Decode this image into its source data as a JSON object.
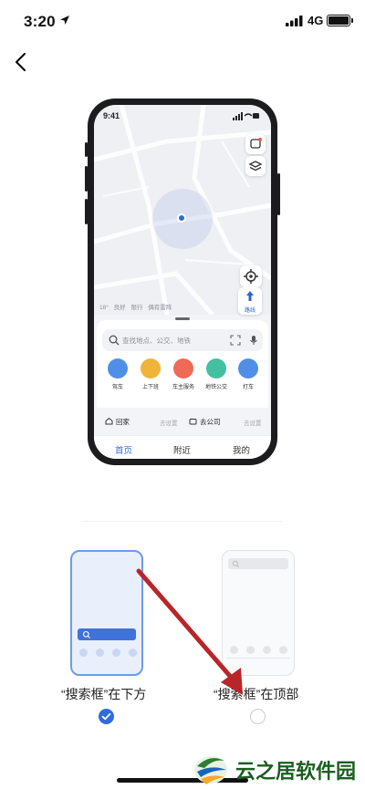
{
  "status_bar": {
    "time": "3:20",
    "network": "4G"
  },
  "phone_preview": {
    "time": "9:41",
    "weather": [
      "18°",
      "良好",
      "限行",
      "偶有雷阵"
    ],
    "search_placeholder": "查找地点、公交、地铁",
    "services": [
      {
        "label": "驾车",
        "color": "#4f8fe8"
      },
      {
        "label": "上下班",
        "color": "#f0b43a"
      },
      {
        "label": "车主服务",
        "color": "#ee6a55"
      },
      {
        "label": "地铁公交",
        "color": "#43c0a0"
      },
      {
        "label": "打车",
        "color": "#4f8fe8"
      }
    ],
    "shortcuts": {
      "home": "回家",
      "home_sub": "去设置",
      "company": "去公司",
      "company_sub": "去设置"
    },
    "nav_label": "路线",
    "tabs": [
      "首页",
      "附近",
      "我的"
    ]
  },
  "options": [
    {
      "label": "“搜索框”在下方",
      "selected": true
    },
    {
      "label": "“搜索框”在顶部",
      "selected": false
    }
  ],
  "watermark": {
    "text": "云之居软件园"
  }
}
